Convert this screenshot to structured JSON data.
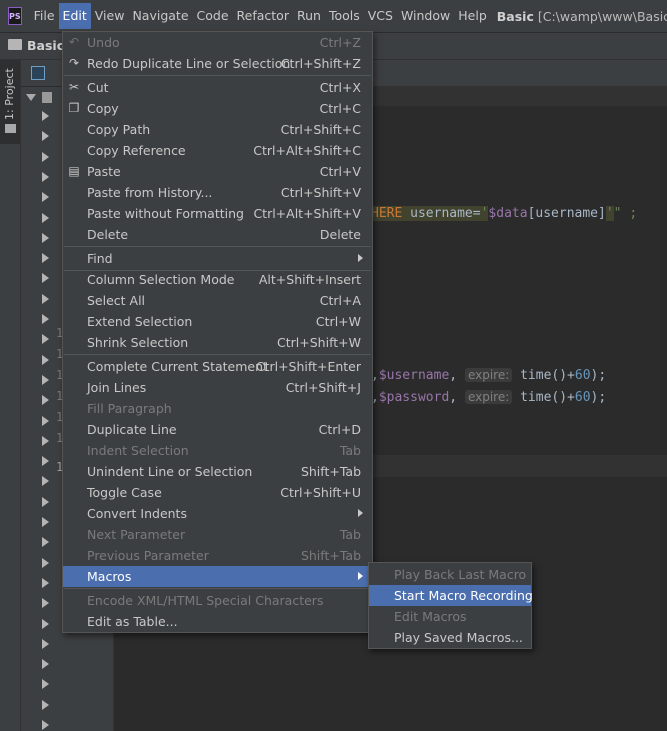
{
  "menubar": {
    "app_icon": "PS",
    "items": [
      "File",
      "Edit",
      "View",
      "Navigate",
      "Code",
      "Refactor",
      "Run",
      "Tools",
      "VCS",
      "Window",
      "Help"
    ],
    "active": "Edit",
    "project_title": "Basic",
    "project_path": "[C:\\wamp\\www\\Basic] -"
  },
  "navbar": {
    "project": "Basic"
  },
  "sidebar": {
    "tab_label": "1: Project"
  },
  "gutter": {
    "numbers": [
      "1",
      "1",
      "1",
      "1",
      "1",
      "1",
      "1"
    ]
  },
  "code": {
    "line1": {
      "kw": "HERE",
      "text": " username=",
      "q1": "'",
      "var": "$data",
      "bracket": "[username]",
      "q2": "'",
      "end": "\" ;"
    },
    "line2": {
      "lead": ",",
      "var": "$username",
      "comma": ",",
      "hint": "expire:",
      "fn": " time()+",
      "num": "60",
      "end": ");"
    },
    "line3": {
      "lead": ",",
      "var": "$password",
      "comma": ",",
      "hint": "expire:",
      "fn": " time()+",
      "num": "60",
      "end": ");"
    }
  },
  "edit_menu": {
    "items": [
      {
        "label": "Undo",
        "shortcut": "Ctrl+Z",
        "disabled": true,
        "icon": "undo-icon"
      },
      {
        "label": "Redo Duplicate Line or Selection",
        "shortcut": "Ctrl+Shift+Z",
        "icon": "redo-icon"
      },
      {
        "label": "Cut",
        "shortcut": "Ctrl+X",
        "icon": "cut-icon"
      },
      {
        "label": "Copy",
        "shortcut": "Ctrl+C",
        "icon": "copy-icon"
      },
      {
        "label": "Copy Path",
        "shortcut": "Ctrl+Shift+C"
      },
      {
        "label": "Copy Reference",
        "shortcut": "Ctrl+Alt+Shift+C"
      },
      {
        "label": "Paste",
        "shortcut": "Ctrl+V",
        "icon": "paste-icon"
      },
      {
        "label": "Paste from History...",
        "shortcut": "Ctrl+Shift+V"
      },
      {
        "label": "Paste without Formatting",
        "shortcut": "Ctrl+Alt+Shift+V"
      },
      {
        "label": "Delete",
        "shortcut": "Delete"
      },
      {
        "label": "Find",
        "shortcut": "",
        "submenu": true
      },
      {
        "label": "Column Selection Mode",
        "shortcut": "Alt+Shift+Insert"
      },
      {
        "label": "Select All",
        "shortcut": "Ctrl+A"
      },
      {
        "label": "Extend Selection",
        "shortcut": "Ctrl+W"
      },
      {
        "label": "Shrink Selection",
        "shortcut": "Ctrl+Shift+W"
      },
      {
        "label": "Complete Current Statement",
        "shortcut": "Ctrl+Shift+Enter"
      },
      {
        "label": "Join Lines",
        "shortcut": "Ctrl+Shift+J"
      },
      {
        "label": "Fill Paragraph",
        "shortcut": "",
        "disabled": true
      },
      {
        "label": "Duplicate Line",
        "shortcut": "Ctrl+D"
      },
      {
        "label": "Indent Selection",
        "shortcut": "Tab",
        "disabled": true
      },
      {
        "label": "Unindent Line or Selection",
        "shortcut": "Shift+Tab"
      },
      {
        "label": "Toggle Case",
        "shortcut": "Ctrl+Shift+U"
      },
      {
        "label": "Convert Indents",
        "shortcut": "",
        "submenu": true
      },
      {
        "label": "Next Parameter",
        "shortcut": "Tab",
        "disabled": true
      },
      {
        "label": "Previous Parameter",
        "shortcut": "Shift+Tab",
        "disabled": true
      },
      {
        "label": "Macros",
        "shortcut": "",
        "submenu": true,
        "selected": true
      },
      {
        "label": "Encode XML/HTML Special Characters",
        "shortcut": "",
        "disabled": true
      },
      {
        "label": "Edit as Table...",
        "shortcut": ""
      }
    ]
  },
  "macros_submenu": {
    "items": [
      {
        "label": "Play Back Last Macro",
        "disabled": true
      },
      {
        "label": "Start Macro Recording",
        "selected": true
      },
      {
        "label": "Edit Macros",
        "disabled": true
      },
      {
        "label": "Play Saved Macros..."
      }
    ]
  },
  "colors": {
    "selection": "#4b6eaf",
    "menu_bg": "#3c3f41",
    "editor_bg": "#2b2b2b"
  }
}
